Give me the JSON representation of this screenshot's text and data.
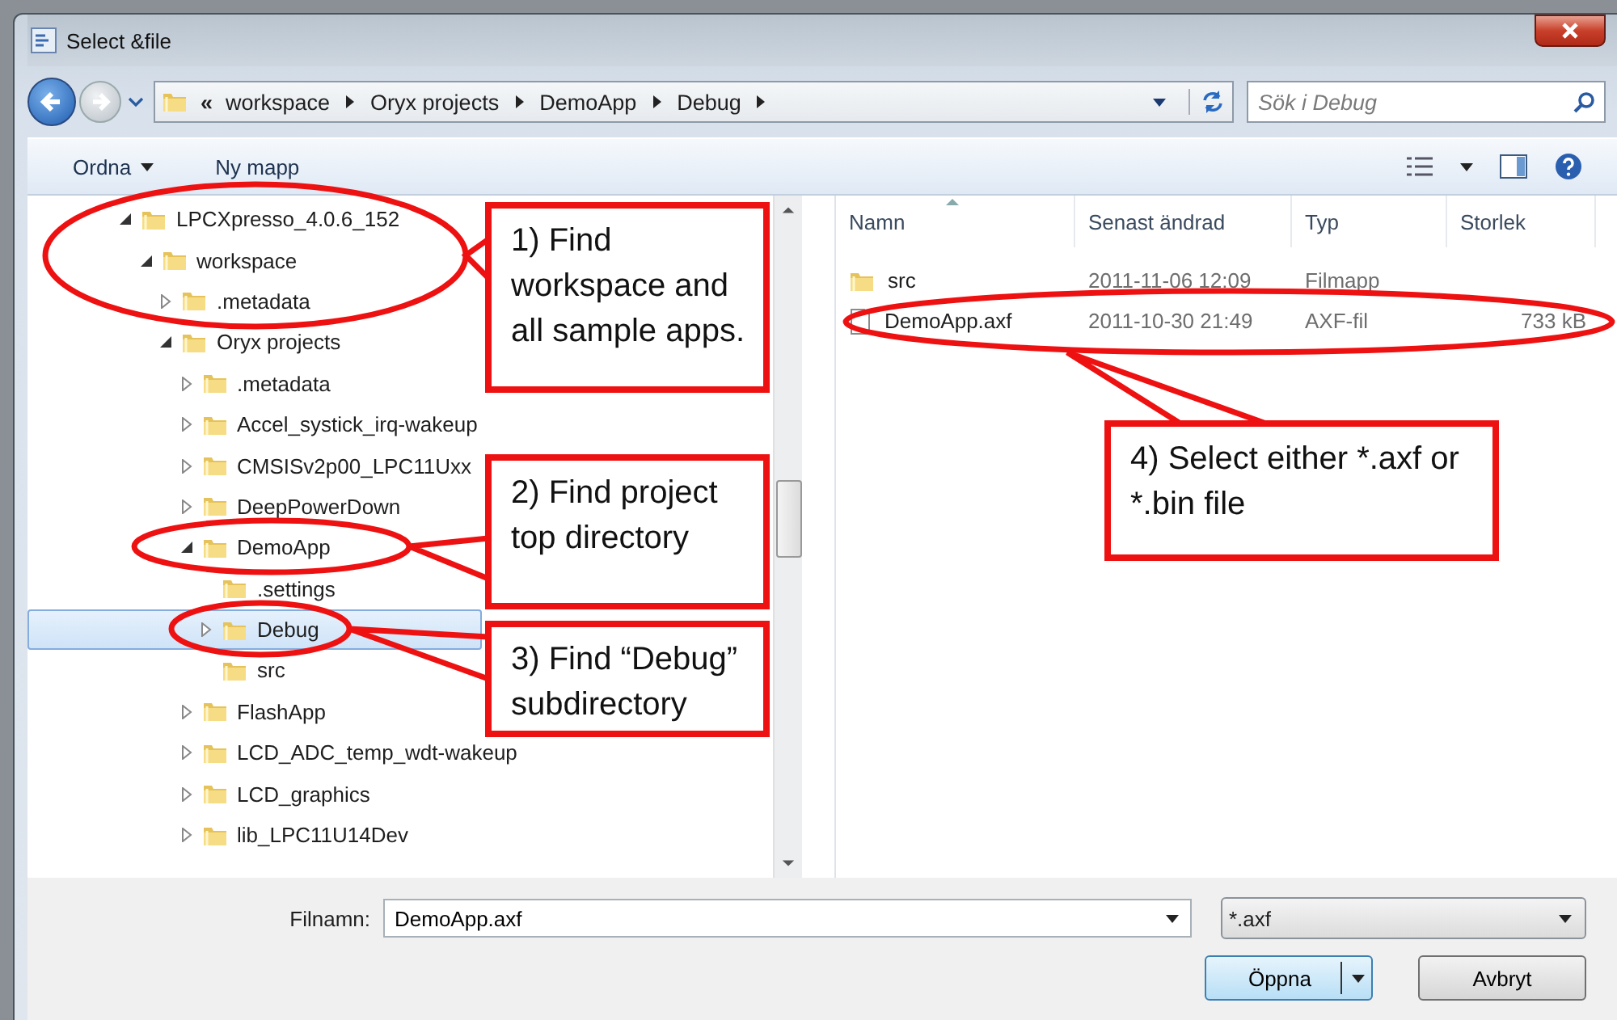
{
  "window": {
    "title": "Select &file"
  },
  "address": {
    "overflow": "«",
    "crumbs": [
      "workspace",
      "Oryx projects",
      "DemoApp",
      "Debug"
    ],
    "search_placeholder": "Sök i Debug"
  },
  "toolbar": {
    "buttons": [
      {
        "label": "Ordna",
        "kind": "menu"
      },
      {
        "label": "Ny mapp",
        "kind": "plain"
      }
    ]
  },
  "tree": [
    {
      "label": "LPCXpresso_4.0.6_152",
      "kind": "expanded",
      "selected": false,
      "children": [
        {
          "label": "workspace",
          "kind": "expanded",
          "selected": false,
          "children": [
            {
              "label": ".metadata",
              "kind": "collapsed",
              "selected": false
            },
            {
              "label": "Oryx projects",
              "kind": "expanded",
              "selected": false,
              "children": [
                {
                  "label": ".metadata",
                  "kind": "collapsed",
                  "selected": false
                },
                {
                  "label": "Accel_systick_irq-wakeup",
                  "kind": "collapsed",
                  "selected": false
                },
                {
                  "label": "CMSISv2p00_LPC11Uxx",
                  "kind": "collapsed",
                  "selected": false
                },
                {
                  "label": "DeepPowerDown",
                  "kind": "collapsed",
                  "selected": false
                },
                {
                  "label": "DemoApp",
                  "kind": "expanded",
                  "selected": false,
                  "children": [
                    {
                      "label": ".settings",
                      "kind": "leaf",
                      "selected": false
                    },
                    {
                      "label": "Debug",
                      "kind": "collapsed",
                      "selected": true
                    },
                    {
                      "label": "src",
                      "kind": "leaf",
                      "selected": false
                    }
                  ]
                },
                {
                  "label": "FlashApp",
                  "kind": "collapsed",
                  "selected": false
                },
                {
                  "label": "LCD_ADC_temp_wdt-wakeup",
                  "kind": "collapsed",
                  "selected": false
                },
                {
                  "label": "LCD_graphics",
                  "kind": "collapsed",
                  "selected": false
                },
                {
                  "label": "lib_LPC11U14Dev",
                  "kind": "collapsed",
                  "selected": false
                }
              ]
            }
          ]
        }
      ]
    }
  ],
  "files": {
    "columns": [
      "Namn",
      "Senast ändrad",
      "Typ",
      "Storlek"
    ],
    "rows": [
      {
        "kind": "folder",
        "cells": [
          "src",
          "2011-11-06 12:09",
          "Filmapp",
          ""
        ]
      },
      {
        "kind": "file",
        "cells": [
          "DemoApp.axf",
          "2011-10-30 21:49",
          "AXF-fil",
          "733 kB"
        ]
      }
    ]
  },
  "footer": {
    "filename_label": "Filnamn:",
    "filename": "DemoApp.axf",
    "filter": "*.axf",
    "open": "Öppna",
    "cancel": "Avbryt"
  },
  "callouts": [
    {
      "text": "1) Find workspace and all sample apps."
    },
    {
      "text": "2) Find project top directory"
    },
    {
      "text": "3) Find “Debug” subdirectory"
    },
    {
      "text": "4) Select either *.axf or *.bin file"
    }
  ]
}
